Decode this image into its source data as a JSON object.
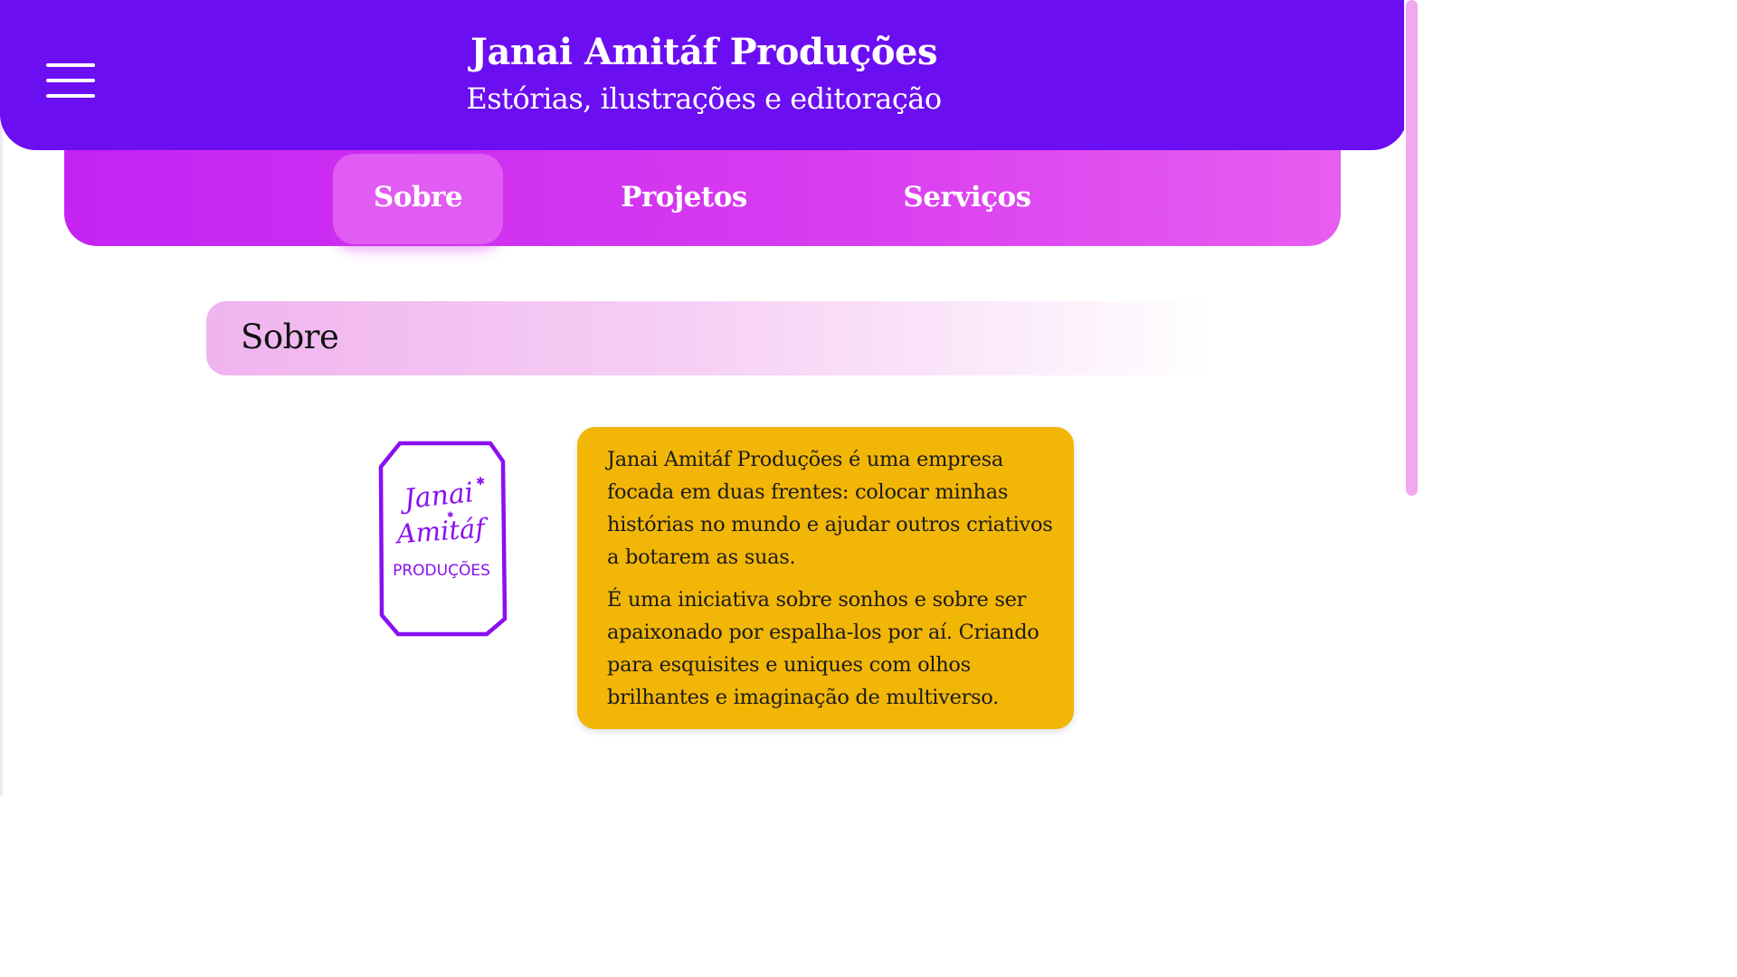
{
  "header": {
    "title": "Janai Amitáf Produções",
    "subtitle": "Estórias, ilustrações e editoração",
    "menu_icon": "hamburger-menu-icon"
  },
  "nav": {
    "items": [
      {
        "label": "Sobre",
        "active": true
      },
      {
        "label": "Projetos",
        "active": false
      },
      {
        "label": "Serviços",
        "active": false
      }
    ]
  },
  "section": {
    "title": "Sobre"
  },
  "logo": {
    "line1": "Janai",
    "line2": "Amitáf",
    "line3": "PRODUÇÕES"
  },
  "about": {
    "paragraphs": [
      "Janai Amitáf Produções é uma empresa focada em duas frentes: colocar minhas histórias no mundo e ajudar outros criativos a botarem as suas.",
      "É uma iniciativa sobre sonhos e sobre ser apaixonado por espalha-los por aí. Criando para esquisites e uniques com olhos brilhantes e imaginação de multiverso."
    ]
  },
  "colors": {
    "header_bg": "#6c0ef2",
    "nav_bg": "#c423f2",
    "nav_active_bg": "#e05cf2",
    "card_bg": "#f2b607",
    "logo_ink": "#8a0ff0",
    "scrollbar_thumb": "#f2a8ef"
  }
}
